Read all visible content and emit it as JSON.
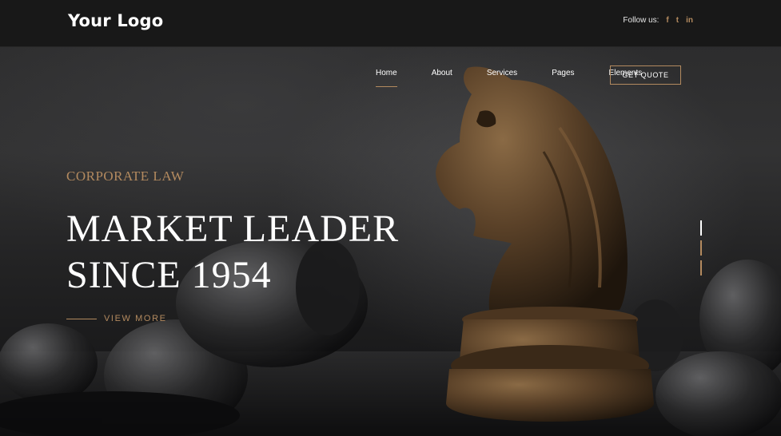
{
  "header": {
    "logo": "Your Logo",
    "follow_label": "Follow us:",
    "social": [
      {
        "icon": "facebook-icon",
        "glyph": "f"
      },
      {
        "icon": "twitter-icon",
        "glyph": "t"
      },
      {
        "icon": "linkedin-icon",
        "glyph": "in"
      }
    ]
  },
  "nav": {
    "items": [
      "Home",
      "About",
      "Services",
      "Pages",
      "Elements"
    ],
    "active": "Home",
    "cta": "GET QUOTE"
  },
  "hero": {
    "eyebrow": "CORPORATE LAW",
    "headline_line1": "MARKET LEADER",
    "headline_line2": "SINCE 1954",
    "cta": "VIEW MORE"
  },
  "slider": {
    "count": 3,
    "active_index": 0
  },
  "colors": {
    "accent": "#b38a5f",
    "background": "#1b1b1c",
    "text": "#ffffff"
  }
}
